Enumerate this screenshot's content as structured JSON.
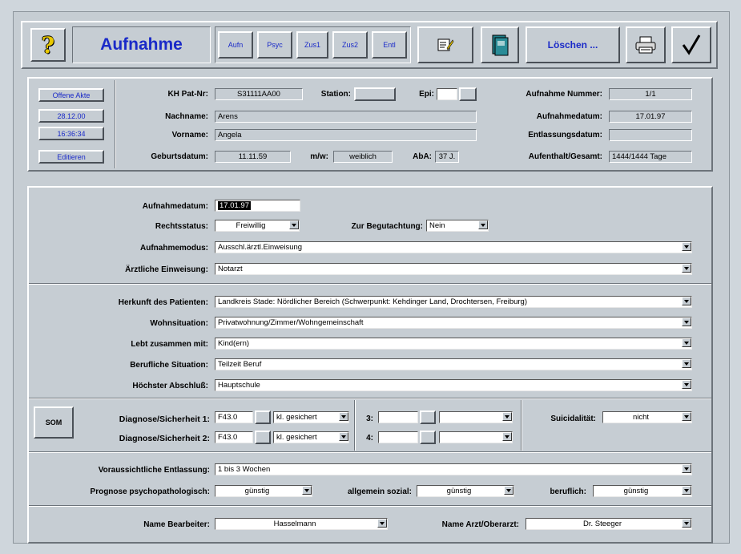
{
  "window_title": "Aufnahme",
  "toolbar": {
    "help_icon": "question-mark-icon",
    "title": "Aufnahme",
    "tabs": [
      "Aufn",
      "Psyc",
      "Zus1",
      "Zus2",
      "Entl"
    ],
    "delete_label": "Löschen ...",
    "edit_icon": "notepad-pencil-icon",
    "book_icon": "book-icon",
    "print_icon": "printer-icon",
    "confirm_icon": "checkmark-icon"
  },
  "sidebar": {
    "buttons": [
      "Offene Akte",
      "28.12.00",
      "16:36:34",
      "Editieren"
    ]
  },
  "patient": {
    "kh_pat_nr_label": "KH Pat-Nr:",
    "kh_pat_nr": "S31111AA00",
    "station_label": "Station:",
    "epi_label": "Epi:",
    "nachname_label": "Nachname:",
    "nachname": "Arens",
    "vorname_label": "Vorname:",
    "vorname": "Angela",
    "geburtsdatum_label": "Geburtsdatum:",
    "geburtsdatum": "11.11.59",
    "mw_label": "m/w:",
    "mw": "weiblich",
    "aba_label": "AbA:",
    "aba": "37 J.",
    "aufnahme_nummer_label": "Aufnahme Nummer:",
    "aufnahme_nummer": "1/1",
    "aufnahmedatum_label": "Aufnahmedatum:",
    "aufnahmedatum": "17.01.97",
    "entlassungsdatum_label": "Entlassungsdatum:",
    "entlassungsdatum": "",
    "aufenthalt_label": "Aufenthalt/Gesamt:",
    "aufenthalt": "1444/1444 Tage"
  },
  "admission": {
    "aufnahmedatum_label": "Aufnahmedatum:",
    "aufnahmedatum": "17.01.97",
    "rechtsstatus_label": "Rechtsstatus:",
    "rechtsstatus": "Freiwillig",
    "begutachtung_label": "Zur Begutachtung:",
    "begutachtung": "Nein",
    "aufnahmemodus_label": "Aufnahmemodus:",
    "aufnahmemodus": "Ausschl.ärztl.Einweisung",
    "einweisung_label": "Ärztliche Einweisung:",
    "einweisung": "Notarzt"
  },
  "social": {
    "herkunft_label": "Herkunft des Patienten:",
    "herkunft": "Landkreis Stade: Nördlicher Bereich (Schwerpunkt: Kehdinger Land, Drochtersen, Freiburg)",
    "wohnsituation_label": "Wohnsituation:",
    "wohnsituation": "Privatwohnung/Zimmer/Wohngemeinschaft",
    "lebt_label": "Lebt zusammen mit:",
    "lebt": "Kind(ern)",
    "beruf_label": "Berufliche Situation:",
    "beruf": "Teilzeit Beruf",
    "abschluss_label": "Höchster Abschluß:",
    "abschluss": "Hauptschule"
  },
  "diagnosis": {
    "som_label": "SOM",
    "diag1_label": "Diagnose/Sicherheit 1:",
    "diag1_code": "F43.0",
    "diag1_sicherheit": "kl. gesichert",
    "diag2_label": "Diagnose/Sicherheit 2:",
    "diag2_code": "F43.0",
    "diag2_sicherheit": "kl. gesichert",
    "diag3_label": "3:",
    "diag4_label": "4:",
    "suizid_label": "Suicidalität:",
    "suizid": "nicht"
  },
  "discharge": {
    "entlassung_label": "Voraussichtliche Entlassung:",
    "entlassung": "1 bis 3 Wochen",
    "prognose_label": "Prognose psychopathologisch:",
    "prognose": "günstig",
    "sozial_label": "allgemein sozial:",
    "sozial": "günstig",
    "beruflich_label": "beruflich:",
    "beruflich": "günstig"
  },
  "staff": {
    "bearbeiter_label": "Name Bearbeiter:",
    "bearbeiter": "Hasselmann",
    "arzt_label": "Name Arzt/Oberarzt:",
    "arzt": "Dr. Steeger"
  }
}
